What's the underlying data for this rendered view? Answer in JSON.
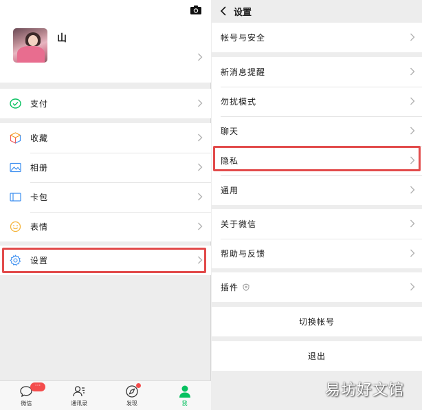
{
  "me": {
    "nickname": "山",
    "menu_pay": [
      "支付"
    ],
    "menu_mid": [
      "收藏",
      "相册",
      "卡包",
      "表情"
    ],
    "menu_settings": [
      "设置"
    ]
  },
  "tabbar": {
    "tabs": [
      "微信",
      "通讯录",
      "发现",
      "我"
    ],
    "chat_badge": "···",
    "active_color": "#07c160"
  },
  "settings": {
    "title": "设置",
    "group1": [
      "帐号与安全"
    ],
    "group2": [
      "新消息提醒",
      "勿扰模式",
      "聊天",
      "隐私",
      "通用"
    ],
    "group3": [
      "关于微信",
      "帮助与反馈"
    ],
    "group4": [
      "插件"
    ],
    "switch_account": "切换帐号",
    "logout": "退出"
  },
  "watermark": "易坊好文馆",
  "colors": {
    "highlight": "#e24b4b",
    "wechat_green": "#07c160",
    "badge_red": "#f44c4c"
  }
}
